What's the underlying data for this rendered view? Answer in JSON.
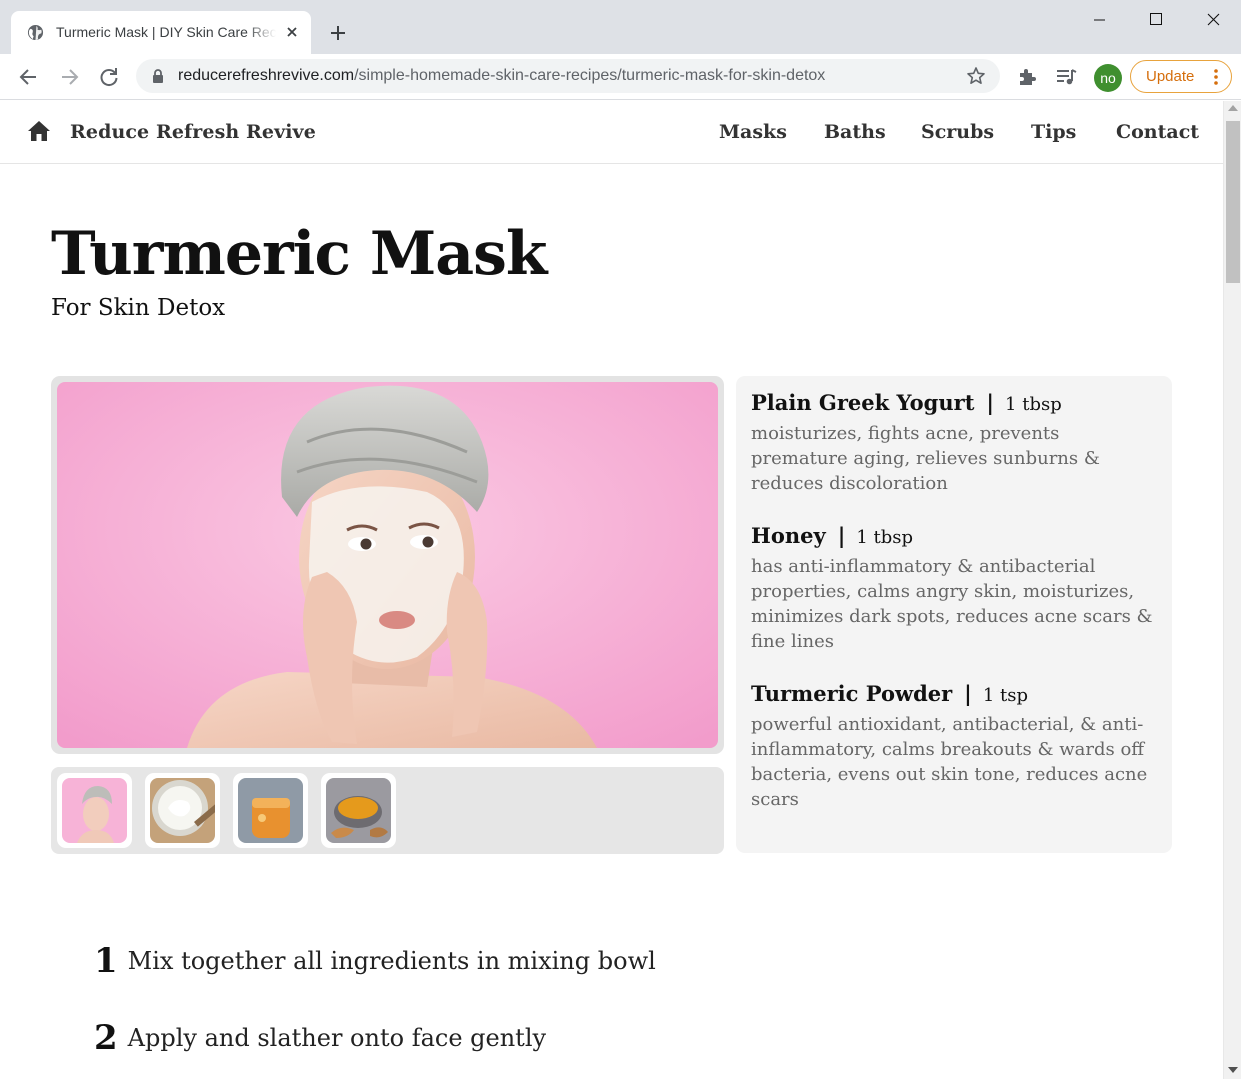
{
  "browser": {
    "tab_title": "Turmeric Mask | DIY Skin Care Recipes",
    "url_host": "reducerefreshrevive.com",
    "url_path": "/simple-homemade-skin-care-recipes/turmeric-mask-for-skin-detox",
    "profile_initials": "no",
    "update_label": "Update",
    "icons": [
      "globe-icon",
      "close-icon",
      "plus-icon",
      "back-icon",
      "forward-icon",
      "reload-icon",
      "lock-icon",
      "star-icon",
      "puzzle-icon",
      "media-queue-icon",
      "kebab-icon"
    ]
  },
  "site": {
    "brand": "Reduce Refresh Revive",
    "nav": [
      "Masks",
      "Baths",
      "Scrubs",
      "Tips",
      "Contact"
    ]
  },
  "recipe": {
    "title": "Turmeric Mask",
    "subtitle": "For Skin Detox",
    "ingredients": [
      {
        "name": "Plain Greek Yogurt",
        "qty": "1 tbsp",
        "desc": "moisturizes, fights acne, prevents premature aging, relieves sunburns & reduces discoloration"
      },
      {
        "name": "Honey",
        "qty": "1 tbsp",
        "desc": "has anti-inflammatory & antibacterial properties, calms angry skin, moisturizes, minimizes dark spots, reduces acne scars & fine lines"
      },
      {
        "name": "Turmeric Powder",
        "qty": "1 tsp",
        "desc": "powerful antioxidant, antibacterial, & anti-inflammatory, calms breakouts & wards off bacteria, evens out skin tone, reduces acne scars"
      }
    ],
    "steps": [
      {
        "num": "1",
        "text": "Mix together all ingredients in mixing bowl"
      },
      {
        "num": "2",
        "text": "Apply and slather onto face gently"
      }
    ]
  },
  "colors": {
    "chrome_bg": "#dee1e6",
    "hero_pink": "#f7b7d8",
    "profile_green": "#3f8f2f",
    "update_orange": "#d56e0c"
  }
}
